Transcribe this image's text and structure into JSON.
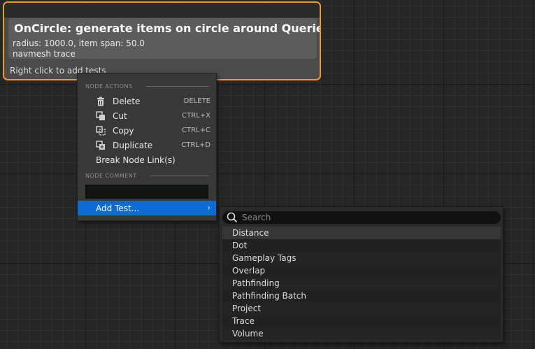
{
  "node": {
    "title": "OnCircle: generate items on circle around Querier",
    "details": [
      "radius: 1000.0, item span: 50.0",
      "navmesh trace"
    ],
    "hint": "Right click to add tests"
  },
  "context_menu": {
    "node_actions_header": "NODE ACTIONS",
    "items": [
      {
        "label": "Delete",
        "shortcut": "DELETE",
        "icon": "trash-icon"
      },
      {
        "label": "Cut",
        "shortcut": "CTRL+X",
        "icon": "cut-icon"
      },
      {
        "label": "Copy",
        "shortcut": "CTRL+C",
        "icon": "copy-icon"
      },
      {
        "label": "Duplicate",
        "shortcut": "CTRL+D",
        "icon": "duplicate-icon"
      }
    ],
    "break_links_label": "Break Node Link(s)",
    "node_comment_header": "NODE COMMENT",
    "comment_value": "",
    "add_test_label": "Add Test..."
  },
  "submenu": {
    "search_placeholder": "Search",
    "items": [
      "Distance",
      "Dot",
      "Gameplay Tags",
      "Overlap",
      "Pathfinding",
      "Pathfinding Batch",
      "Project",
      "Trace",
      "Volume"
    ]
  },
  "colors": {
    "node_border": "#f19c1a",
    "highlight": "#0e6bd6",
    "menu_bg": "#383838",
    "submenu_bg": "#2a2a2a"
  }
}
